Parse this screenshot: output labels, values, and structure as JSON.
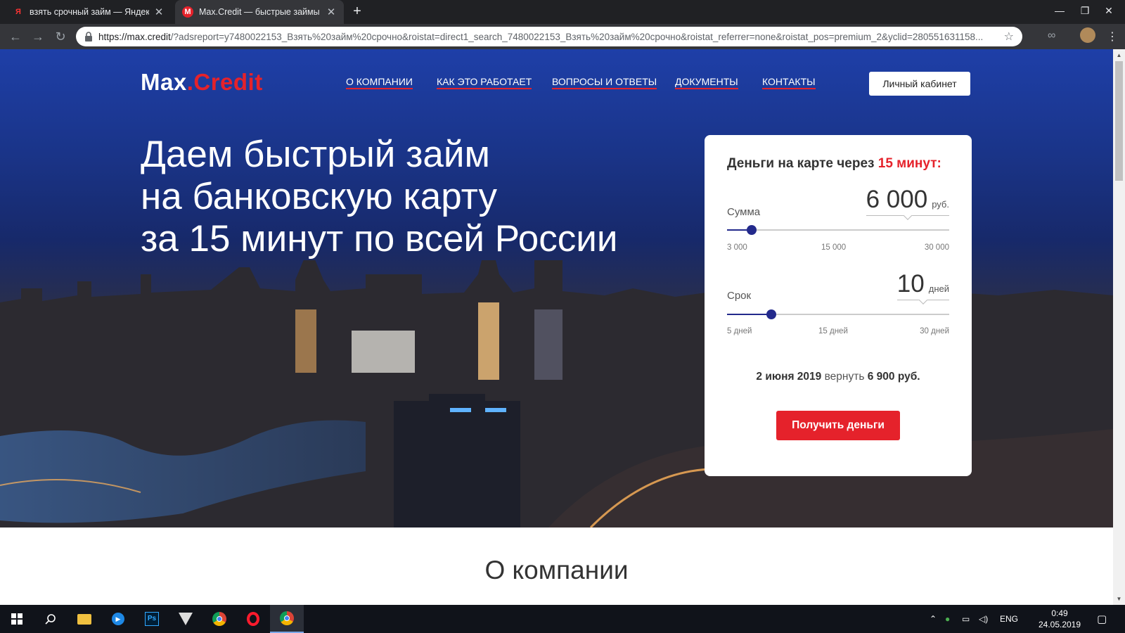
{
  "browser": {
    "tabs": [
      {
        "title": "взять срочный займ — Яндекс:",
        "favicon": "Я"
      },
      {
        "title": "Max.Credit — быстрые займы на",
        "favicon": "M"
      }
    ],
    "url_domain": "https://max.credit",
    "url_rest": "/?adsreport=y7480022153_Взять%20займ%20срочно&roistat=direct1_search_7480022153_Взять%20займ%20срочно&roistat_referrer=none&roistat_pos=premium_2&yclid=280551631158..."
  },
  "site": {
    "logo": {
      "part1": "Max",
      "dot": ".",
      "part2": "Credit"
    },
    "nav": [
      "О КОМПАНИИ",
      "КАК ЭТО РАБОТАЕТ",
      "ВОПРОСЫ И ОТВЕТЫ",
      "ДОКУМЕНТЫ",
      "КОНТАКТЫ"
    ],
    "cabinet_button": "Личный кабинет",
    "headline": [
      "Даем быстрый займ",
      "на банковскую карту",
      "за 15 минут по всей России"
    ],
    "section_title": "О компании"
  },
  "calculator": {
    "title": "Деньги на карте через",
    "title_accent": "15 минут:",
    "amount": {
      "label": "Сумма",
      "value": "6 000",
      "unit": "руб.",
      "numeric": 6000,
      "min": 3000,
      "max": 30000,
      "ticks": [
        "3 000",
        "15 000",
        "30 000"
      ]
    },
    "term": {
      "label": "Срок",
      "value": "10",
      "unit": "дней",
      "numeric": 10,
      "min": 5,
      "max": 30,
      "ticks": [
        "5 дней",
        "15 дней",
        "30 дней"
      ]
    },
    "summary_date": "2 июня 2019",
    "summary_mid": "вернуть",
    "summary_amount": "6 900 руб.",
    "submit": "Получить деньги",
    "accent_color": "#e5222b",
    "slider_color": "#232a8c"
  },
  "taskbar": {
    "lang": "ENG",
    "time": "0:49",
    "date": "24.05.2019"
  }
}
